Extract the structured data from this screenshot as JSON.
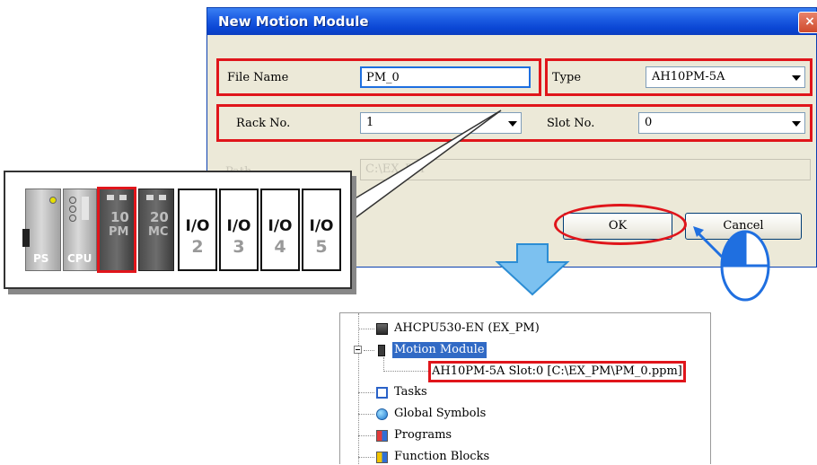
{
  "dialog": {
    "title": "New Motion Module",
    "close_glyph": "×",
    "file_name_label": "File Name",
    "file_name_value": "PM_0",
    "type_label": "Type",
    "type_value": "AH10PM-5A",
    "rack_label": "Rack No.",
    "rack_value": "1",
    "slot_label": "Slot No.",
    "slot_value": "0",
    "path_label": "Path",
    "path_value": "C:\\EX_PM",
    "ok_label": "OK",
    "cancel_label": "Cancel"
  },
  "rack": {
    "modules": [
      {
        "label": "PS"
      },
      {
        "label": "CPU"
      },
      {
        "top": "10",
        "bottom": "PM"
      },
      {
        "top": "20",
        "bottom": "MC"
      },
      {
        "io": "I/O",
        "num": "2"
      },
      {
        "io": "I/O",
        "num": "3"
      },
      {
        "io": "I/O",
        "num": "4"
      },
      {
        "io": "I/O",
        "num": "5"
      }
    ]
  },
  "tree": {
    "root": "AHCPU530-EN  (EX_PM)",
    "motion_module": "Motion Module",
    "motion_child": "AH10PM-5A Slot:0 [C:\\EX_PM\\PM_0.ppm]",
    "tasks": "Tasks",
    "global_symbols": "Global Symbols",
    "programs": "Programs",
    "function_blocks": "Function Blocks"
  },
  "colors": {
    "highlight_red": "#e0151b",
    "arrow_blue": "#7cc1f0",
    "title_blue": "#0a46d4",
    "selection_blue": "#316ac5"
  },
  "icons": [
    "close-icon",
    "dropdown-arrow-icon",
    "mouse-icon",
    "down-arrow-icon",
    "plc-icon",
    "module-icon",
    "tasks-icon",
    "globe-icon",
    "programs-icon",
    "function-blocks-icon",
    "collapse-icon"
  ]
}
